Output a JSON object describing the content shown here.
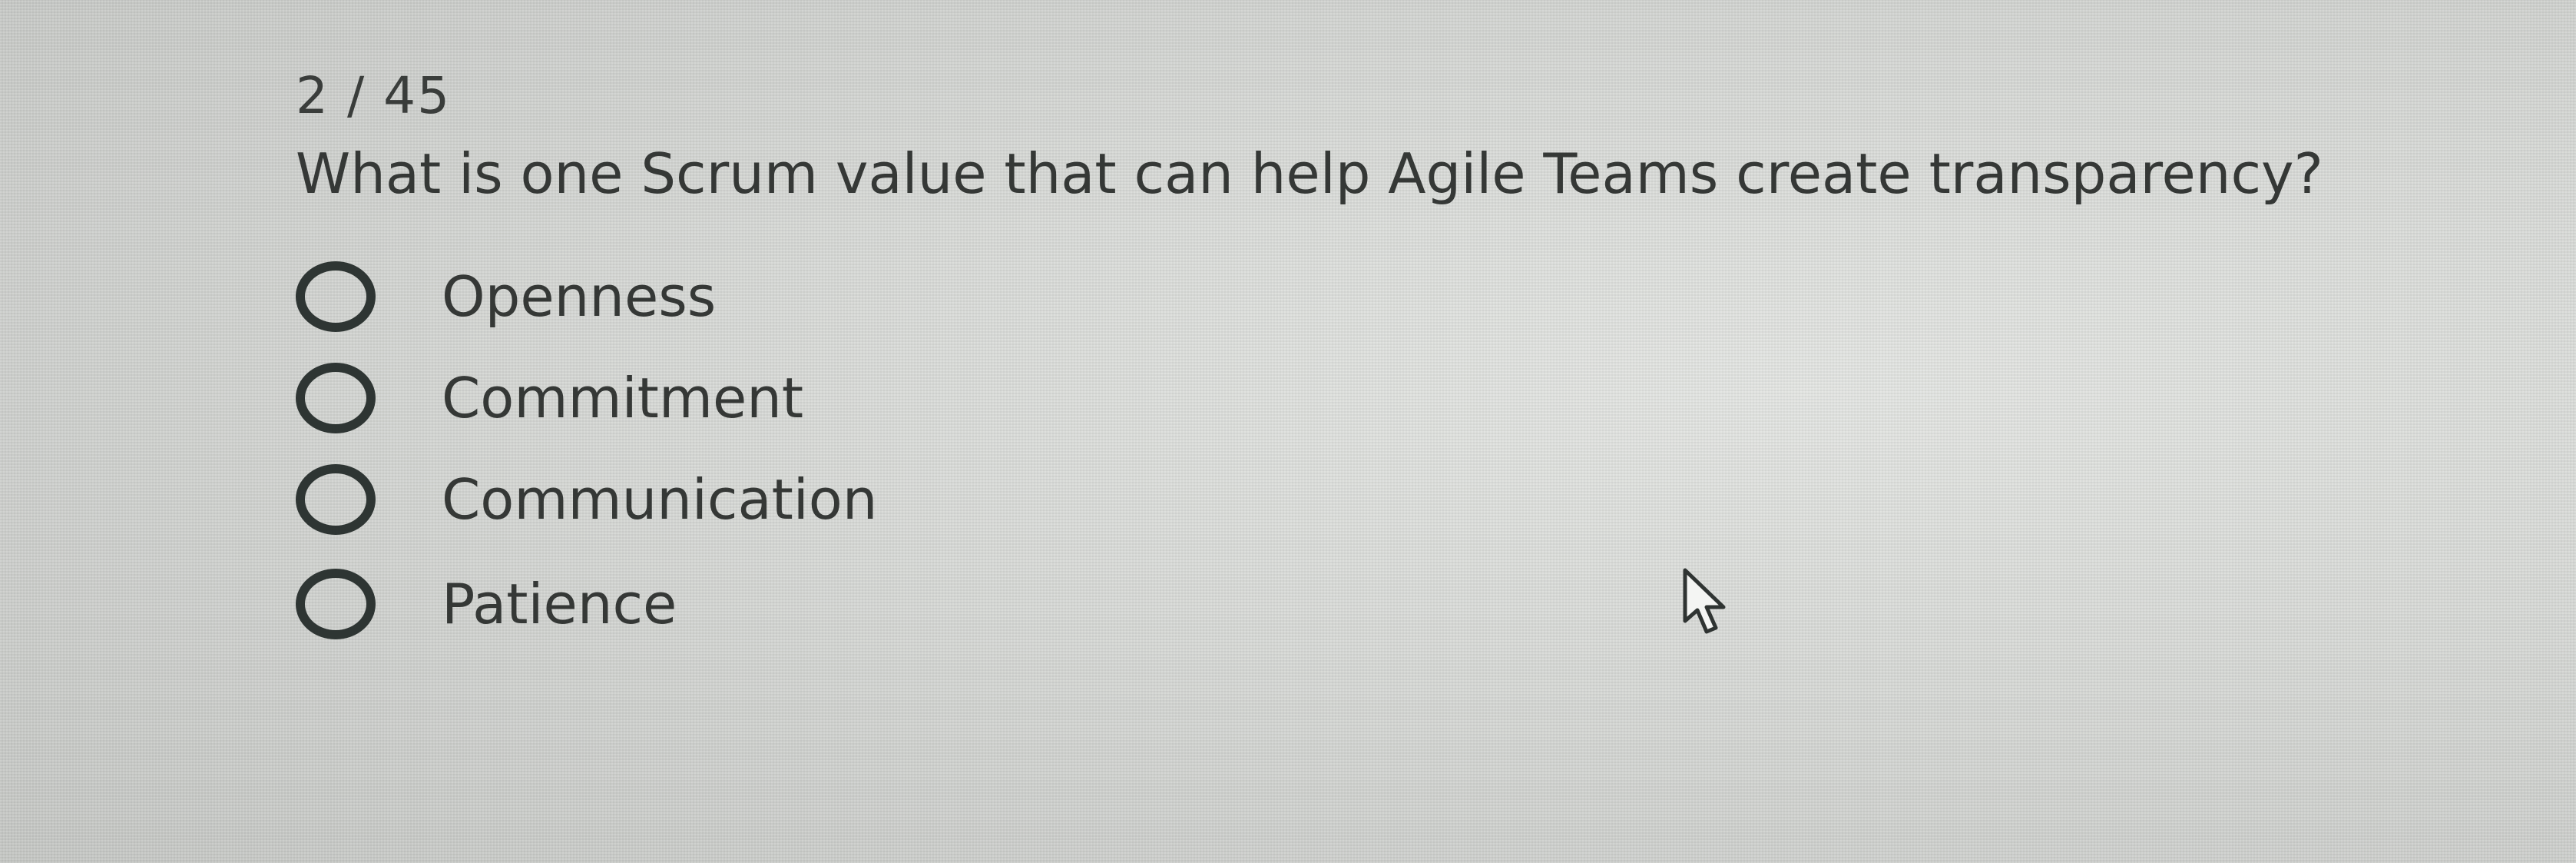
{
  "quiz": {
    "counter": "2  / 45",
    "question": "What is one Scrum value that can help Agile Teams create transparency?",
    "options": [
      {
        "label": "Openness",
        "selected": false
      },
      {
        "label": "Commitment",
        "selected": false
      },
      {
        "label": "Communication",
        "selected": false
      },
      {
        "label": "Patience",
        "selected": false
      }
    ]
  },
  "icons": {
    "pointer": "mouse-pointer-icon"
  },
  "colors": {
    "text": "#353836",
    "radio_border": "#2e3533",
    "background": "#d3d5d2"
  }
}
